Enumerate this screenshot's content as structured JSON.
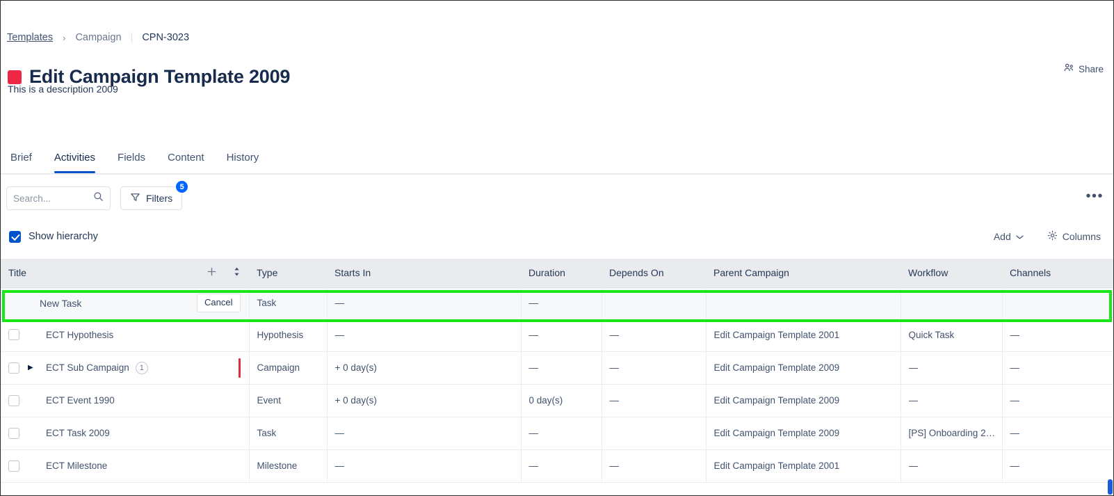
{
  "breadcrumb": {
    "root": "Templates",
    "section": "Campaign",
    "key": "CPN-3023",
    "chevron": "›",
    "pipe": "|"
  },
  "header": {
    "title": "Edit Campaign Template 2009",
    "description": "This is a description 2009",
    "status_color": "#ee2744",
    "share_label": "Share",
    "share_icon": "people-share-icon"
  },
  "tabs": [
    {
      "label": "Brief",
      "active": false
    },
    {
      "label": "Activities",
      "active": true
    },
    {
      "label": "Fields",
      "active": false
    },
    {
      "label": "Content",
      "active": false
    },
    {
      "label": "History",
      "active": false
    }
  ],
  "toolbar": {
    "search_placeholder": "Search...",
    "search_value": "",
    "search_icon": "search-icon",
    "filters_label": "Filters",
    "filters_icon": "funnel-icon",
    "filters_count": "5",
    "filters_badge_color": "#0065ff",
    "kebab_icon": "more-options-icon",
    "kebab_glyph": "•••"
  },
  "options_bar": {
    "show_hierarchy_label": "Show hierarchy",
    "show_hierarchy_checked": true,
    "add_label": "Add",
    "add_icon": "chevron-down-icon",
    "columns_label": "Columns",
    "columns_icon": "gear-icon"
  },
  "table": {
    "columns": [
      "Title",
      "Type",
      "Starts In",
      "Duration",
      "Depends On",
      "Parent Campaign",
      "Workflow",
      "Channels"
    ],
    "title_header_icons": {
      "add": "plus-icon",
      "sort": "sort-updown-icon"
    },
    "new_row": {
      "title": "New Task",
      "cancel_label": "Cancel",
      "type": "Task",
      "starts_in": "—",
      "duration": "—",
      "depends_on": "",
      "parent_campaign": "",
      "workflow": "",
      "channels": "",
      "highlight_color": "#19e619"
    },
    "rows": [
      {
        "title": "ECT Hypothesis",
        "expandable": false,
        "child_count": "",
        "marker": false,
        "type": "Hypothesis",
        "starts_in": "—",
        "duration": "—",
        "depends_on": "—",
        "parent_campaign": "Edit Campaign Template 2001",
        "workflow": "Quick Task",
        "channels": "—"
      },
      {
        "title": "ECT Sub Campaign",
        "expandable": true,
        "child_count": "1",
        "marker": true,
        "type": "Campaign",
        "starts_in": "+ 0 day(s)",
        "duration": "—",
        "depends_on": "—",
        "parent_campaign": "Edit Campaign Template 2009",
        "workflow": "—",
        "channels": "—"
      },
      {
        "title": "ECT Event 1990",
        "expandable": false,
        "child_count": "",
        "marker": false,
        "type": "Event",
        "starts_in": "+ 0 day(s)",
        "duration": "0 day(s)",
        "depends_on": "—",
        "parent_campaign": "Edit Campaign Template 2009",
        "workflow": "—",
        "channels": "—"
      },
      {
        "title": "ECT Task 2009",
        "expandable": false,
        "child_count": "",
        "marker": false,
        "type": "Task",
        "starts_in": "—",
        "duration": "—",
        "depends_on": "",
        "parent_campaign": "Edit Campaign Template 2009",
        "workflow": "[PS] Onboarding 2....",
        "channels": "—"
      },
      {
        "title": "ECT Milestone",
        "expandable": false,
        "child_count": "",
        "marker": false,
        "type": "Milestone",
        "starts_in": "—",
        "duration": "—",
        "depends_on": "—",
        "parent_campaign": "Edit Campaign Template 2001",
        "workflow": "—",
        "channels": "—"
      }
    ]
  }
}
